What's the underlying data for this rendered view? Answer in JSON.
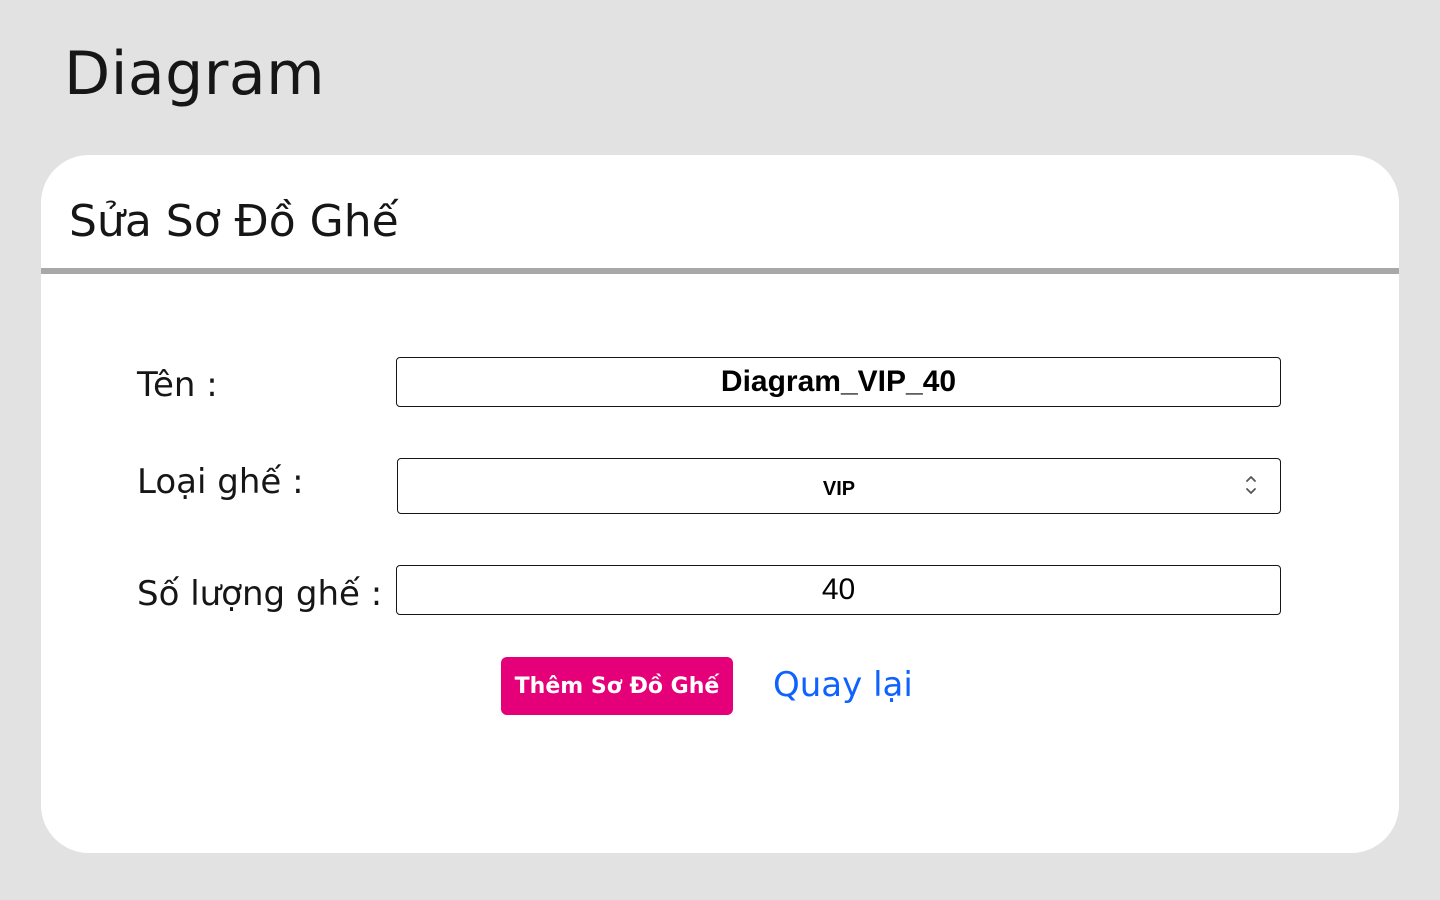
{
  "page": {
    "title": "Diagram"
  },
  "card": {
    "title": "Sửa Sơ Đồ Ghế"
  },
  "form": {
    "name_label": "Tên :",
    "name_value": "Diagram_VIP_40",
    "type_label": "Loại ghế :",
    "type_value": "VIP",
    "count_label": "Số lượng ghế :",
    "count_value": "40"
  },
  "actions": {
    "submit_label": "Thêm Sơ Đồ Ghế",
    "back_label": "Quay lại"
  },
  "colors": {
    "background": "#e2e2e2",
    "card": "#ffffff",
    "divider": "#a8a8a8",
    "primary_button": "#e5007a",
    "link": "#0f62fe"
  },
  "icons": {
    "select_arrow": "chevron-up-down-icon"
  }
}
